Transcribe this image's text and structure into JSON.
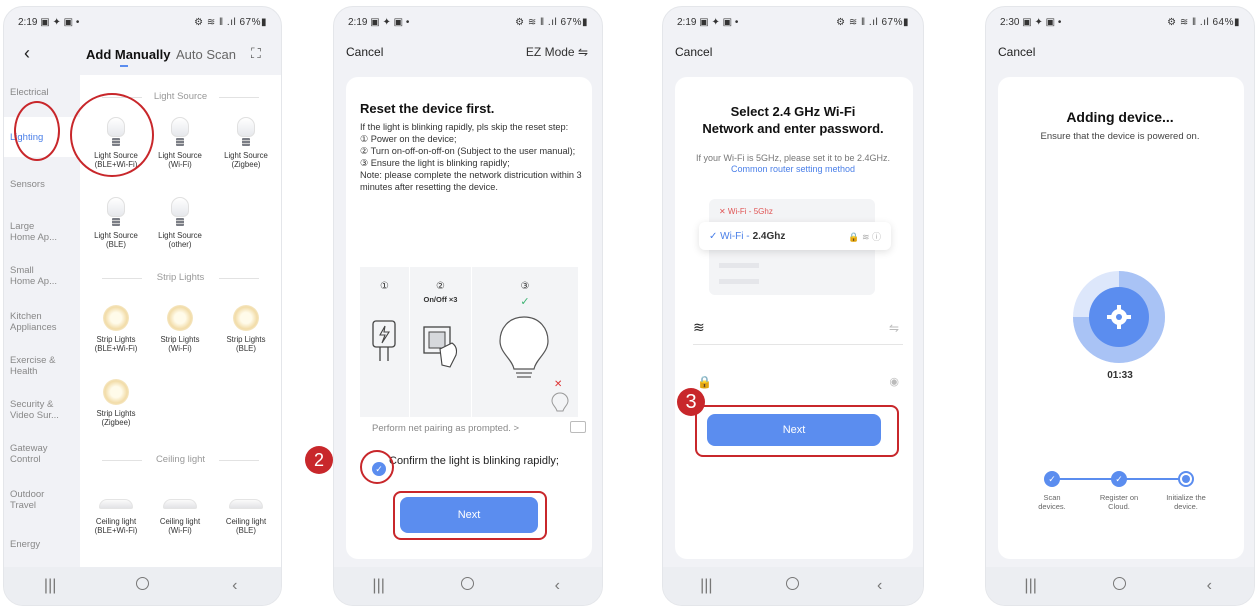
{
  "colors": {
    "accent": "#5b8def",
    "annotation": "#c8272b",
    "link": "#4a7fe8"
  },
  "badges": {
    "step2": "2",
    "step3": "3"
  },
  "screen1": {
    "status": {
      "time": "2:19",
      "left_icons": "▣ ✦ ▣ •",
      "right": "⚙ ≋ ‖ .ıl 67%▮"
    },
    "tabs": {
      "manual": "Add Manually",
      "auto": "Auto Scan"
    },
    "sidebar": [
      {
        "label": "Electrical"
      },
      {
        "label": "Lighting"
      },
      {
        "label": "Sensors"
      },
      {
        "label": "Large\nHome Ap..."
      },
      {
        "label": "Small\nHome Ap..."
      },
      {
        "label": "Kitchen\nAppliances"
      },
      {
        "label": "Exercise &\nHealth"
      },
      {
        "label": "Security &\nVideo Sur..."
      },
      {
        "label": "Gateway\nControl"
      },
      {
        "label": "Outdoor\nTravel"
      },
      {
        "label": "Energy"
      }
    ],
    "sections": {
      "light_source": "Light Source",
      "strip_lights": "Strip Lights",
      "ceiling_light": "Ceiling light"
    },
    "light_devices": [
      {
        "label": "Light Source\n(BLE+Wi-Fi)"
      },
      {
        "label": "Light Source\n(Wi-Fi)"
      },
      {
        "label": "Light Source\n(Zigbee)"
      },
      {
        "label": "Light Source\n(BLE)"
      },
      {
        "label": "Light Source\n(other)"
      }
    ],
    "strip_devices": [
      {
        "label": "Strip Lights\n(BLE+Wi-Fi)"
      },
      {
        "label": "Strip Lights\n(Wi-Fi)"
      },
      {
        "label": "Strip Lights\n(BLE)"
      },
      {
        "label": "Strip Lights\n(Zigbee)"
      }
    ],
    "ceiling_devices": [
      {
        "label": "Ceiling light\n(BLE+Wi-Fi)"
      },
      {
        "label": "Ceiling light\n(Wi-Fi)"
      },
      {
        "label": "Ceiling light\n(BLE)"
      }
    ]
  },
  "screen2": {
    "status": {
      "time": "2:19",
      "left_icons": "▣ ✦ ▣ •",
      "right": "⚙ ≋ ‖ .ıl 67%▮"
    },
    "cancel": "Cancel",
    "mode": "EZ Mode ⇋",
    "title": "Reset the device first.",
    "lines": [
      "If the light is blinking rapidly, pls skip the reset step:",
      "① Power on the device;",
      "② Turn on-off-on-off-on (Subject to the user manual);",
      "③ Ensure the light is blinking rapidly;",
      "Note: please complete the network districution within 3 minutes after resetting the device."
    ],
    "illus": {
      "n1": "①",
      "n2": "②",
      "n2b": "On/Off ×3",
      "n3": "③"
    },
    "perform": "Perform net pairing as prompted. >",
    "confirm": "Confirm the light is blinking rapidly;",
    "next": "Next"
  },
  "screen3": {
    "status": {
      "time": "2:19",
      "left_icons": "▣ ✦ ▣ •",
      "right": "⚙ ≋ ‖ .ıl 67%▮"
    },
    "cancel": "Cancel",
    "title": "Select 2.4 GHz Wi-Fi\nNetwork and enter password.",
    "sub": "If your Wi-Fi is 5GHz, please set it to be 2.4GHz.",
    "link": "Common router setting method",
    "wifi5": "✕ Wi-Fi - 5Ghz",
    "wifi24_prefix": "✓ Wi-Fi - ",
    "wifi24_band": "2.4Ghz",
    "next": "Next"
  },
  "screen4": {
    "status": {
      "time": "2:30",
      "left_icons": "▣ ✦ ▣ •",
      "right": "⚙ ≋ ‖ .ıl 64%▮"
    },
    "cancel": "Cancel",
    "title": "Adding device...",
    "sub": "Ensure that the device is powered on.",
    "timer": "01:33",
    "progress_fraction": 0.75,
    "steps": [
      {
        "label": "Scan\ndevices."
      },
      {
        "label": "Register on\nCloud."
      },
      {
        "label": "Initialize the\ndevice."
      }
    ]
  }
}
